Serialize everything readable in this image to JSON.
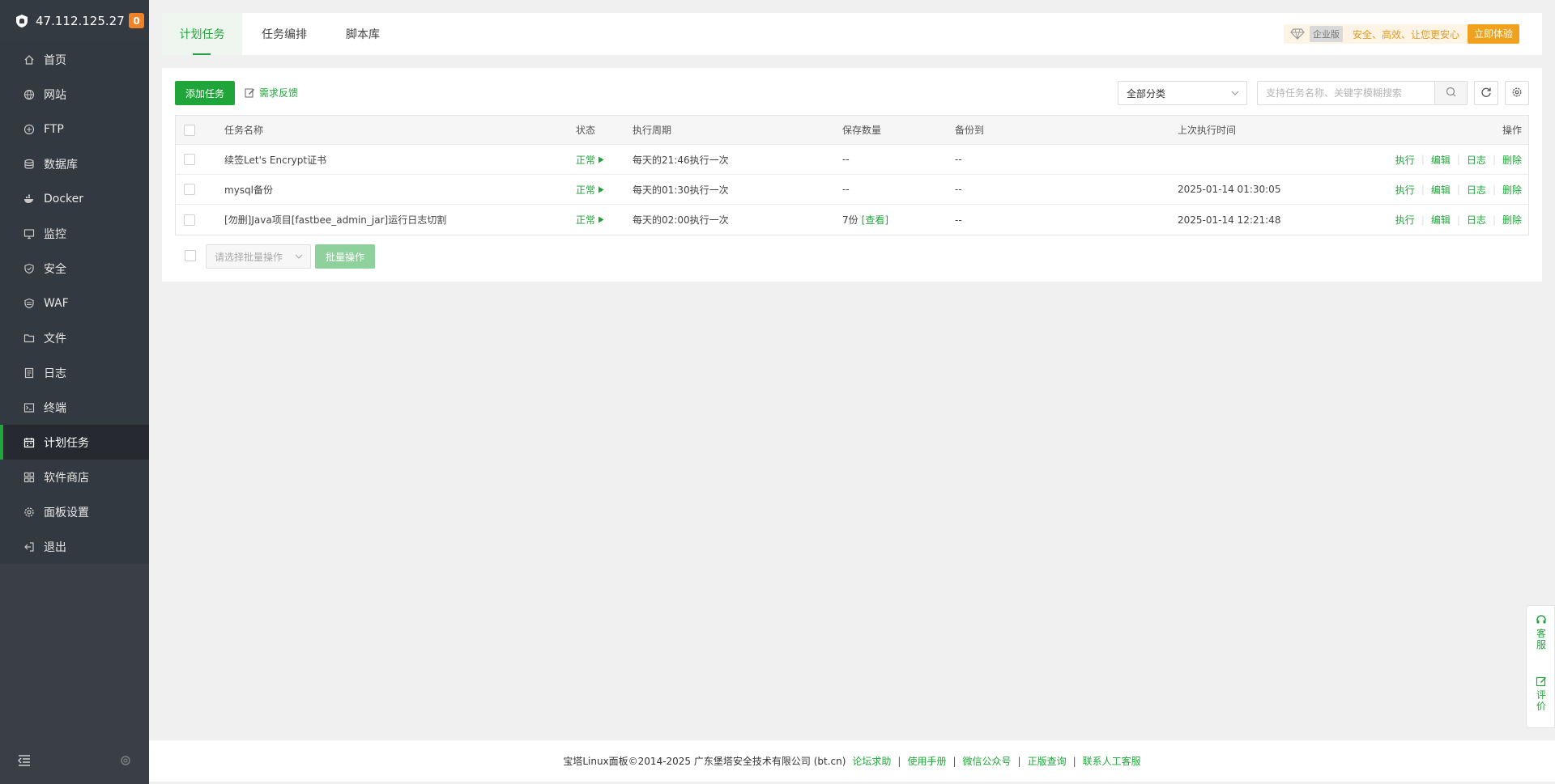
{
  "sidebar": {
    "server_ip": "47.112.125.27",
    "badge_count": "0",
    "items": [
      {
        "label": "首页",
        "icon": "home-icon"
      },
      {
        "label": "网站",
        "icon": "globe-icon"
      },
      {
        "label": "FTP",
        "icon": "ftp-icon"
      },
      {
        "label": "数据库",
        "icon": "database-icon"
      },
      {
        "label": "Docker",
        "icon": "docker-icon"
      },
      {
        "label": "监控",
        "icon": "monitor-icon"
      },
      {
        "label": "安全",
        "icon": "shield-icon"
      },
      {
        "label": "WAF",
        "icon": "waf-icon"
      },
      {
        "label": "文件",
        "icon": "folder-icon"
      },
      {
        "label": "日志",
        "icon": "log-icon"
      },
      {
        "label": "终端",
        "icon": "terminal-icon"
      },
      {
        "label": "计划任务",
        "icon": "calendar-icon"
      },
      {
        "label": "软件商店",
        "icon": "grid-icon"
      },
      {
        "label": "面板设置",
        "icon": "gear-icon"
      },
      {
        "label": "退出",
        "icon": "logout-icon"
      }
    ],
    "active_index": 11
  },
  "tabs": [
    {
      "label": "计划任务"
    },
    {
      "label": "任务编排"
    },
    {
      "label": "脚本库"
    }
  ],
  "promo": {
    "edition": "企业版",
    "slogan": "安全、高效、让您更安心",
    "try_label": "立即体验"
  },
  "toolbar": {
    "add_label": "添加任务",
    "feedback_label": "需求反馈",
    "category_value": "全部分类",
    "search_placeholder": "支持任务名称、关键字模糊搜索"
  },
  "table": {
    "headers": {
      "name": "任务名称",
      "status": "状态",
      "cycle": "执行周期",
      "keep": "保存数量",
      "backup": "备份到",
      "last": "上次执行时间",
      "ops": "操作"
    },
    "rows": [
      {
        "name": "续签Let's Encrypt证书",
        "status": "正常",
        "cycle": "每天的21:46执行一次",
        "keep": "--",
        "keep_link": "",
        "backup": "--",
        "last": ""
      },
      {
        "name": "mysql备份",
        "status": "正常",
        "cycle": "每天的01:30执行一次",
        "keep": "--",
        "keep_link": "",
        "backup": "--",
        "last": "2025-01-14 01:30:05"
      },
      {
        "name": "[勿删]Java项目[fastbee_admin_jar]运行日志切割",
        "status": "正常",
        "cycle": "每天的02:00执行一次",
        "keep": "7份",
        "keep_link": "[查看]",
        "backup": "--",
        "last": "2025-01-14 12:21:48"
      }
    ],
    "ops": {
      "run": "执行",
      "edit": "编辑",
      "log": "日志",
      "delete": "删除"
    }
  },
  "batch": {
    "select_placeholder": "请选择批量操作",
    "button_label": "批量操作"
  },
  "float": {
    "service_label": "客服",
    "rate_label": "评价"
  },
  "footer": {
    "copyright": "宝塔Linux面板©2014-2025 广东堡塔安全技术有限公司 (bt.cn)",
    "links": [
      "论坛求助",
      "使用手册",
      "微信公众号",
      "正版查询",
      "联系人工客服"
    ]
  },
  "colors": {
    "brand": "#20a53a",
    "sidebar": "#3a3f47",
    "promo": "#f0a21e",
    "badge": "#f0832a"
  }
}
